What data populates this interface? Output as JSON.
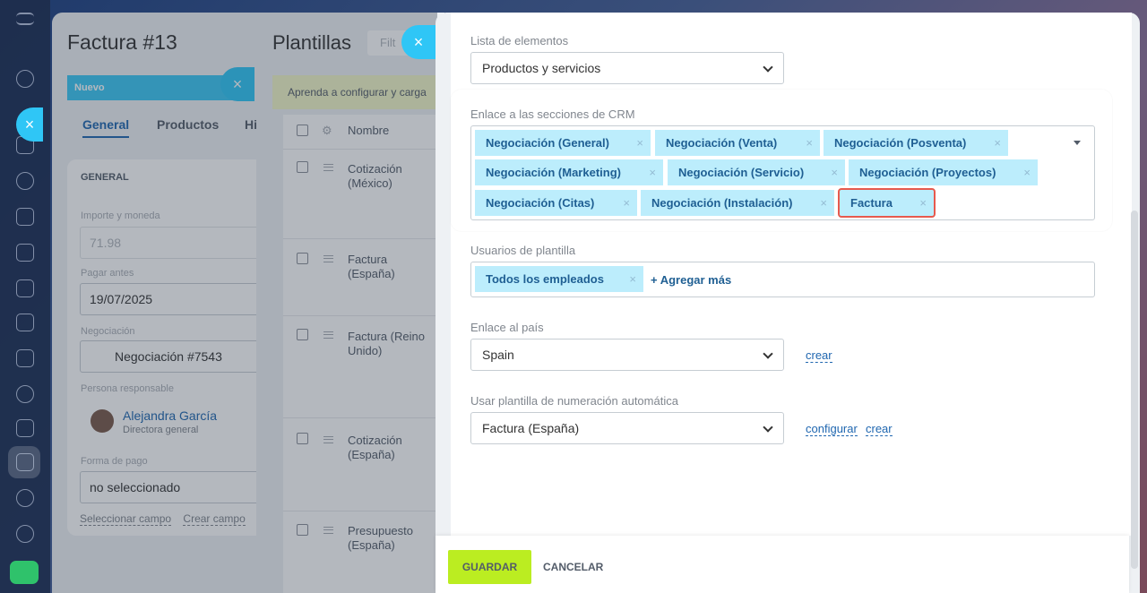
{
  "invoice": {
    "title": "Factura #13",
    "status": "Nuevo",
    "tabs": [
      "General",
      "Productos",
      "Hi"
    ],
    "section_title": "GENERAL",
    "fields": [
      {
        "label": "Importe y moneda",
        "value": "71.98"
      },
      {
        "label": "Pagar antes",
        "value": "19/07/2025"
      },
      {
        "label": "Negociación",
        "value": "Negociación #7543"
      },
      {
        "label": "Persona responsable",
        "name": "Alejandra García",
        "role": "Directora general"
      },
      {
        "label": "Forma de pago",
        "value": "no seleccionado"
      }
    ],
    "links": [
      "Seleccionar campo",
      "Crear campo"
    ]
  },
  "templates": {
    "title": "Plantillas",
    "filter_placeholder": "Filt",
    "hint": "Aprenda a configurar y carga",
    "column_name": "Nombre",
    "rows": [
      "Cotización (México)",
      "Factura (España)",
      "Factura (Reino Unido)",
      "Cotización (España)",
      "Presupuesto (España)"
    ]
  },
  "form": {
    "element_list": {
      "label": "Lista de elementos",
      "value": "Productos y servicios"
    },
    "crm_link": {
      "label": "Enlace a las secciones de CRM",
      "tags": [
        "Negociación (General)",
        "Negociación (Venta)",
        "Negociación (Posventa)",
        "Negociación (Marketing)",
        "Negociación (Servicio)",
        "Negociación (Proyectos)",
        "Negociación (Citas)",
        "Negociación (Instalación)",
        "Factura"
      ],
      "highlighted_tag": "Factura"
    },
    "users": {
      "label": "Usuarios de plantilla",
      "tag": "Todos los empleados",
      "add_more": "+ Agregar más"
    },
    "country": {
      "label": "Enlace al país",
      "value": "Spain",
      "create": "crear"
    },
    "numbering": {
      "label": "Usar plantilla de numeración automática",
      "value": "Factura (España)",
      "configure": "configurar",
      "create": "crear"
    },
    "remove_glyph": "×"
  },
  "footer": {
    "save": "GUARDAR",
    "cancel": "CANCELAR"
  },
  "close_glyph": "×"
}
